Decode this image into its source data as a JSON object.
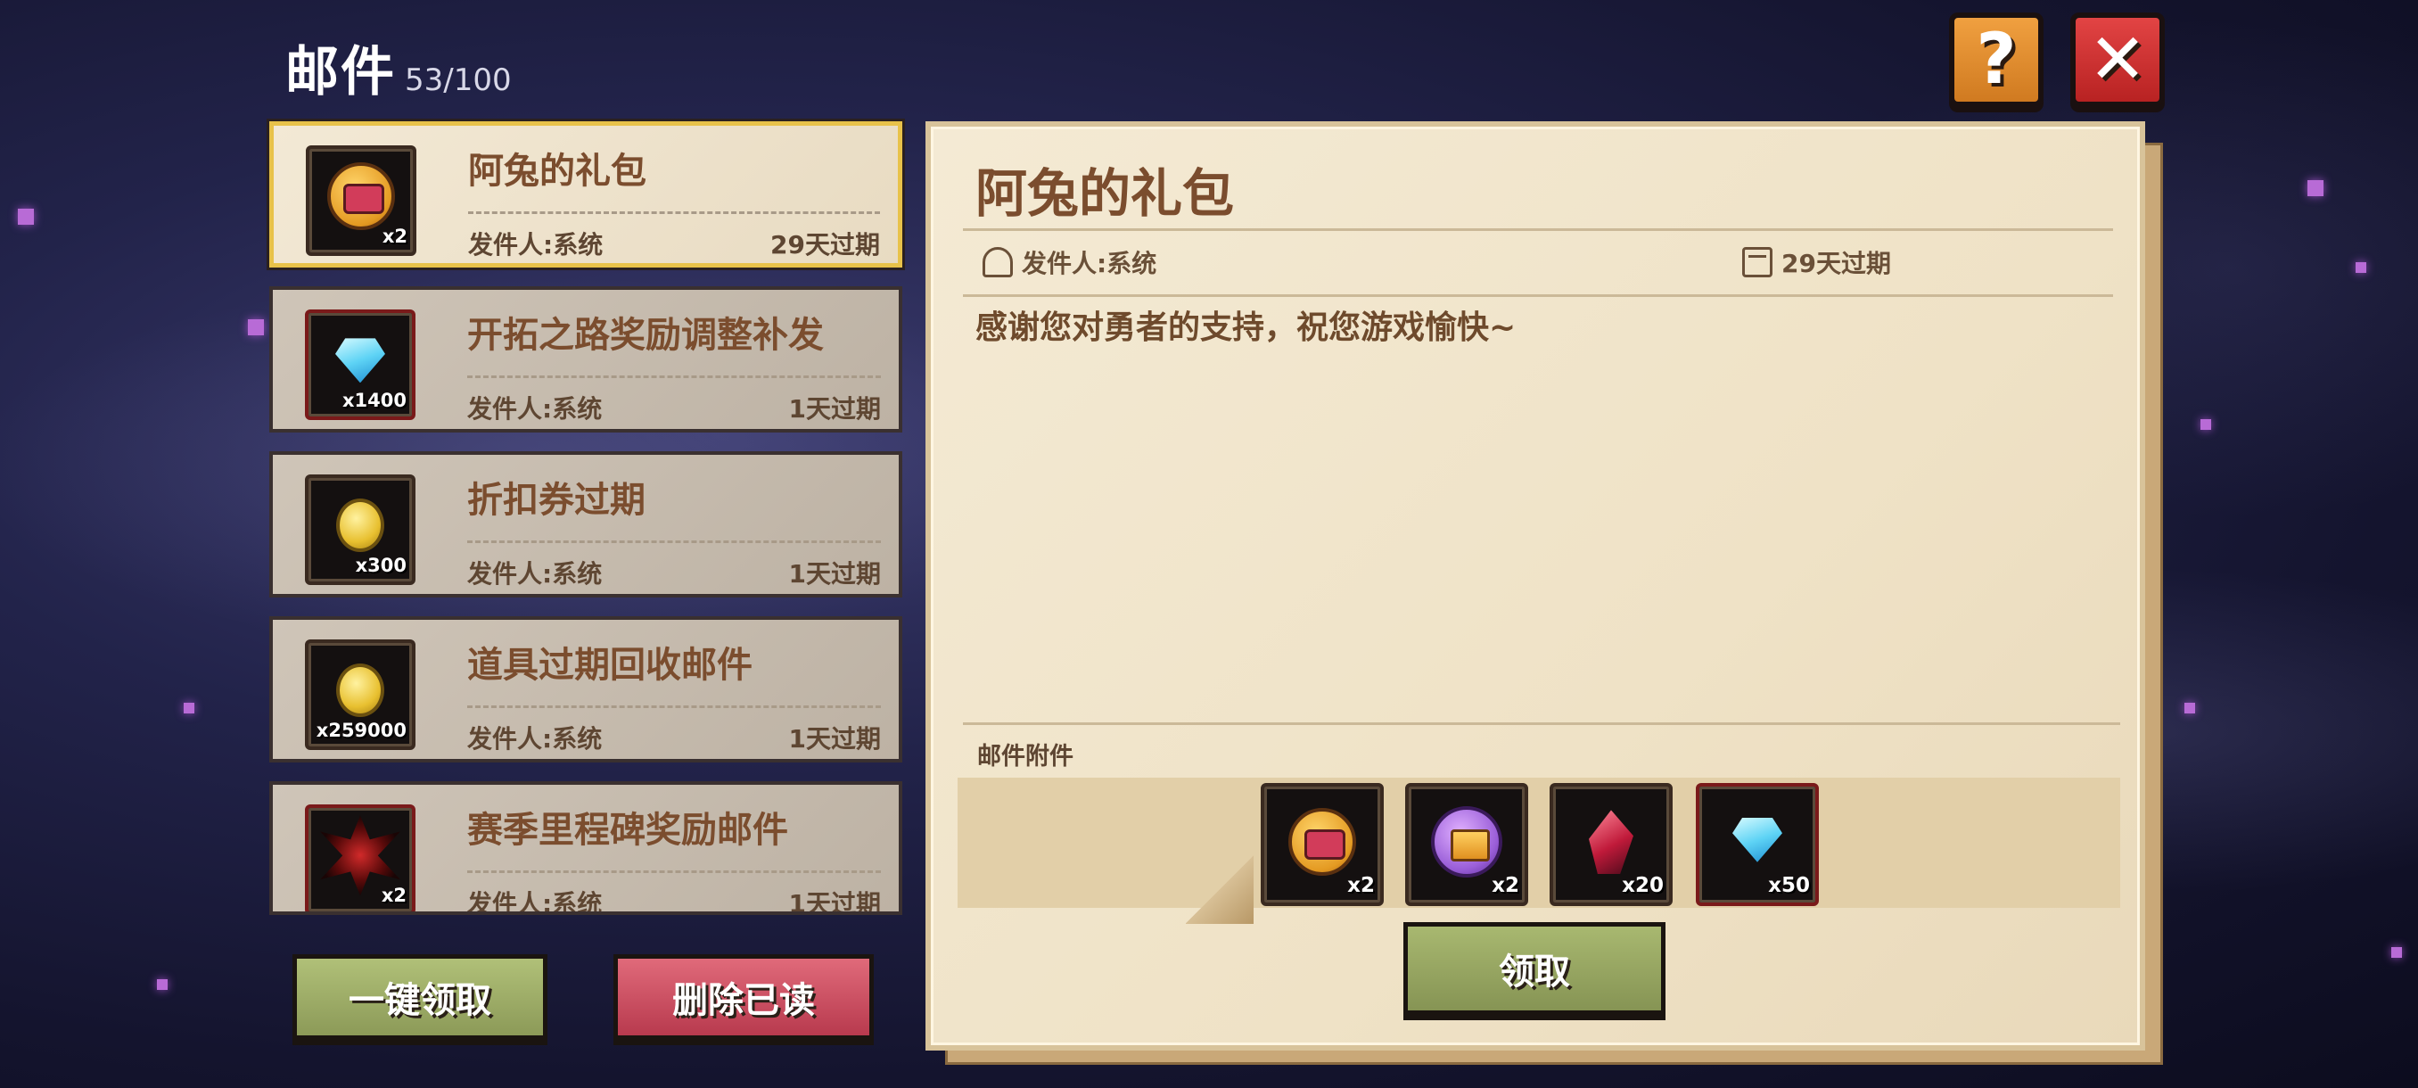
{
  "header": {
    "title": "邮件",
    "count": "53/100"
  },
  "top_buttons": {
    "help": "?",
    "close": "✕"
  },
  "mails": [
    {
      "subject": "阿兔的礼包",
      "sender": "发件人:系统",
      "expire": "29天过期",
      "icon": "gift-chest-icon",
      "qty": "x2",
      "active": true
    },
    {
      "subject": "开拓之路奖励调整补发",
      "sender": "发件人:系统",
      "expire": "1天过期",
      "icon": "diamond-icon",
      "qty": "x1400"
    },
    {
      "subject": "折扣券过期",
      "sender": "发件人:系统",
      "expire": "1天过期",
      "icon": "gold-coin-icon",
      "qty": "x300"
    },
    {
      "subject": "道具过期回收邮件",
      "sender": "发件人:系统",
      "expire": "1天过期",
      "icon": "gold-coin-icon",
      "qty": "x259000"
    },
    {
      "subject": "赛季里程碑奖励邮件",
      "sender": "发件人:系统",
      "expire": "1天过期",
      "icon": "demon-emblem-icon",
      "qty": "x2"
    }
  ],
  "buttons": {
    "claim_all": "一键领取",
    "delete_read": "删除已读",
    "claim": "领取"
  },
  "detail": {
    "title": "阿兔的礼包",
    "sender": "发件人:系统",
    "expire": "29天过期",
    "body": "感谢您对勇者的支持，祝您游戏愉快~",
    "attachments_label": "邮件附件",
    "attachments": [
      {
        "icon": "gift-chest-icon",
        "qty": "x2"
      },
      {
        "icon": "purple-chest-icon",
        "qty": "x2"
      },
      {
        "icon": "red-crystal-icon",
        "qty": "x20"
      },
      {
        "icon": "diamond-icon",
        "qty": "x50"
      }
    ]
  },
  "colors": {
    "accent_orange": "#e08a2c",
    "close_red": "#d23030",
    "claim_green": "#98a862",
    "delete_red": "#cc4e62",
    "subject_brown": "#7b4d2e"
  }
}
